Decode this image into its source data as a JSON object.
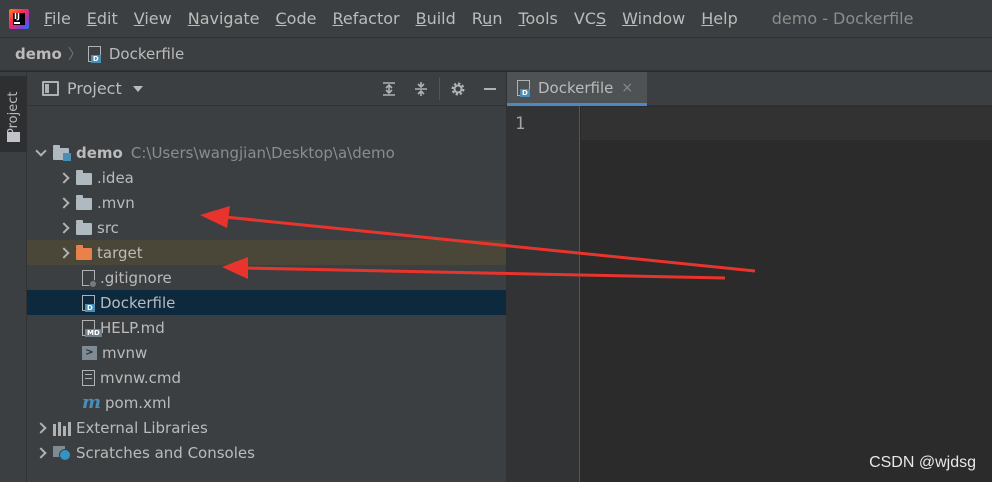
{
  "menubar": {
    "items": [
      {
        "label": "File",
        "u": "F",
        "rest": "ile"
      },
      {
        "label": "Edit",
        "u": "E",
        "rest": "dit"
      },
      {
        "label": "View",
        "u": "V",
        "rest": "iew"
      },
      {
        "label": "Navigate",
        "u": "N",
        "rest": "avigate"
      },
      {
        "label": "Code",
        "u": "C",
        "rest": "ode"
      },
      {
        "label": "Refactor",
        "u": "R",
        "rest": "efactor"
      },
      {
        "label": "Build",
        "u": "B",
        "rest": "uild"
      },
      {
        "label": "Run",
        "u": "u",
        "rest": "",
        "pre": "R",
        "post": "n"
      },
      {
        "label": "Tools",
        "u": "T",
        "rest": "ools"
      },
      {
        "label": "VCS",
        "u": "S",
        "rest": "",
        "pre": "VC"
      },
      {
        "label": "Window",
        "u": "W",
        "rest": "indow"
      },
      {
        "label": "Help",
        "u": "H",
        "rest": "elp"
      }
    ],
    "window_title": "demo - Dockerfile"
  },
  "breadcrumb": {
    "root": "demo",
    "separator": "〉",
    "file": "Dockerfile"
  },
  "left_strip": {
    "tab_label": "Project"
  },
  "project_panel": {
    "title": "Project",
    "tools": [
      "expand-all-icon",
      "collapse-all-icon",
      "gear-icon",
      "hide-icon"
    ]
  },
  "tree": {
    "root": {
      "label": "demo",
      "path": "C:\\Users\\wangjian\\Desktop\\a\\demo"
    },
    "folders": [
      {
        "label": ".idea"
      },
      {
        "label": ".mvn"
      },
      {
        "label": "src"
      },
      {
        "label": "target"
      }
    ],
    "files": [
      {
        "label": ".gitignore"
      },
      {
        "label": "Dockerfile"
      },
      {
        "label": "HELP.md"
      },
      {
        "label": "mvnw"
      },
      {
        "label": "mvnw.cmd"
      },
      {
        "label": "pom.xml"
      }
    ],
    "extras": [
      {
        "label": "External Libraries"
      },
      {
        "label": "Scratches and Consoles"
      }
    ],
    "file_tags": {
      "docker": "D",
      "md": "MD",
      "maven": "m",
      "terminal": ">"
    }
  },
  "editor": {
    "tab_label": "Dockerfile",
    "tab_close": "×",
    "line_numbers": [
      "1"
    ]
  },
  "colors": {
    "selection_target": "#4a4638",
    "selection_dockerfile": "#0d293e",
    "annotation_arrow": "#e8342c",
    "folder_excluded": "#e8814a"
  },
  "watermark": "CSDN @wjdsg"
}
